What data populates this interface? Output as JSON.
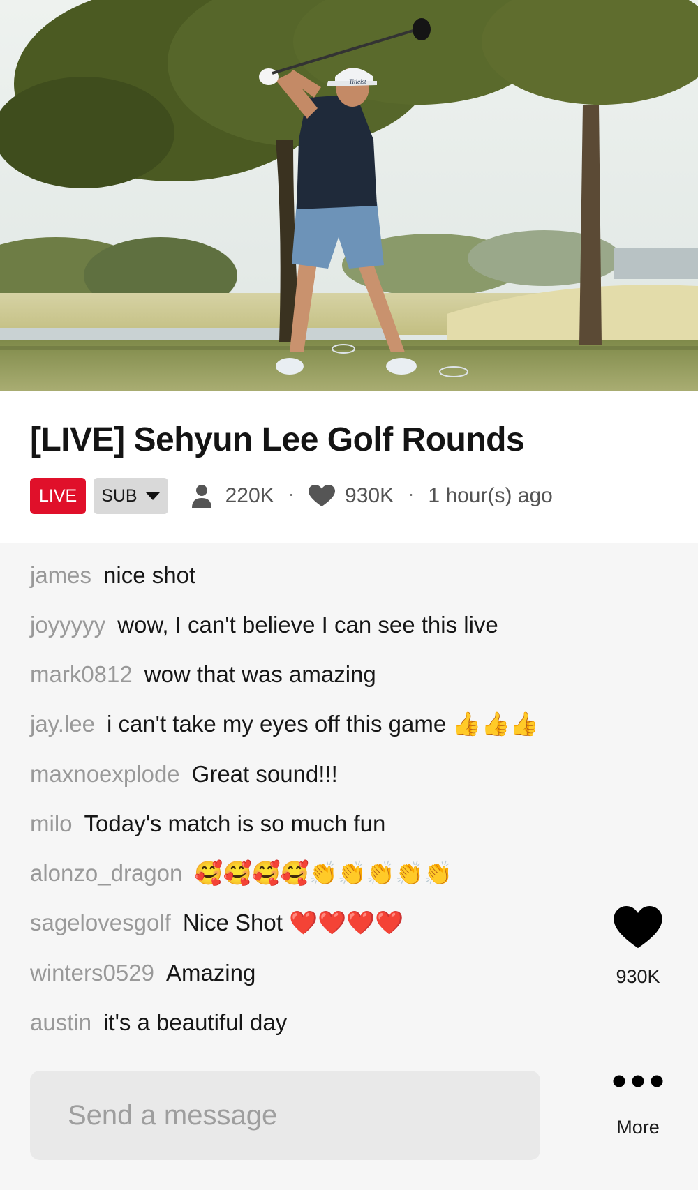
{
  "stream": {
    "title": "[LIVE] Sehyun Lee Golf Rounds",
    "live_badge": "LIVE",
    "sub_badge": "SUB",
    "viewers": "220K",
    "likes": "930K",
    "posted": "1 hour(s) ago",
    "separator": "·",
    "cap_text": "Titleist"
  },
  "chat": {
    "messages": [
      {
        "user": "james",
        "text": "nice shot"
      },
      {
        "user": "joyyyyy",
        "text": "wow, I can't believe I can see this live"
      },
      {
        "user": "mark0812",
        "text": "wow that was amazing"
      },
      {
        "user": "jay.lee",
        "text": "i can't take my eyes off this game 👍👍👍"
      },
      {
        "user": "maxnoexplode",
        "text": "Great sound!!!"
      },
      {
        "user": "milo",
        "text": "Today's match is so much fun"
      },
      {
        "user": "alonzo_dragon",
        "text": "🥰🥰🥰🥰👏👏👏👏👏"
      },
      {
        "user": "sagelovesgolf",
        "text": "Nice Shot ❤️❤️❤️❤️"
      },
      {
        "user": "winters0529",
        "text": "Amazing"
      },
      {
        "user": "austin",
        "text": "it's a beautiful day"
      }
    ],
    "input_placeholder": "Send a message"
  },
  "actions": {
    "like_count": "930K",
    "more_label": "More"
  },
  "icons": {
    "viewers": "person-icon",
    "likes": "heart-icon",
    "like_action": "heart-icon",
    "more": "more-dots-icon",
    "sub": "caret-down-icon"
  },
  "colors": {
    "live_red": "#e0102a",
    "sub_gray": "#d9d9d9",
    "chat_bg": "#f6f6f6",
    "username_gray": "#999999"
  }
}
